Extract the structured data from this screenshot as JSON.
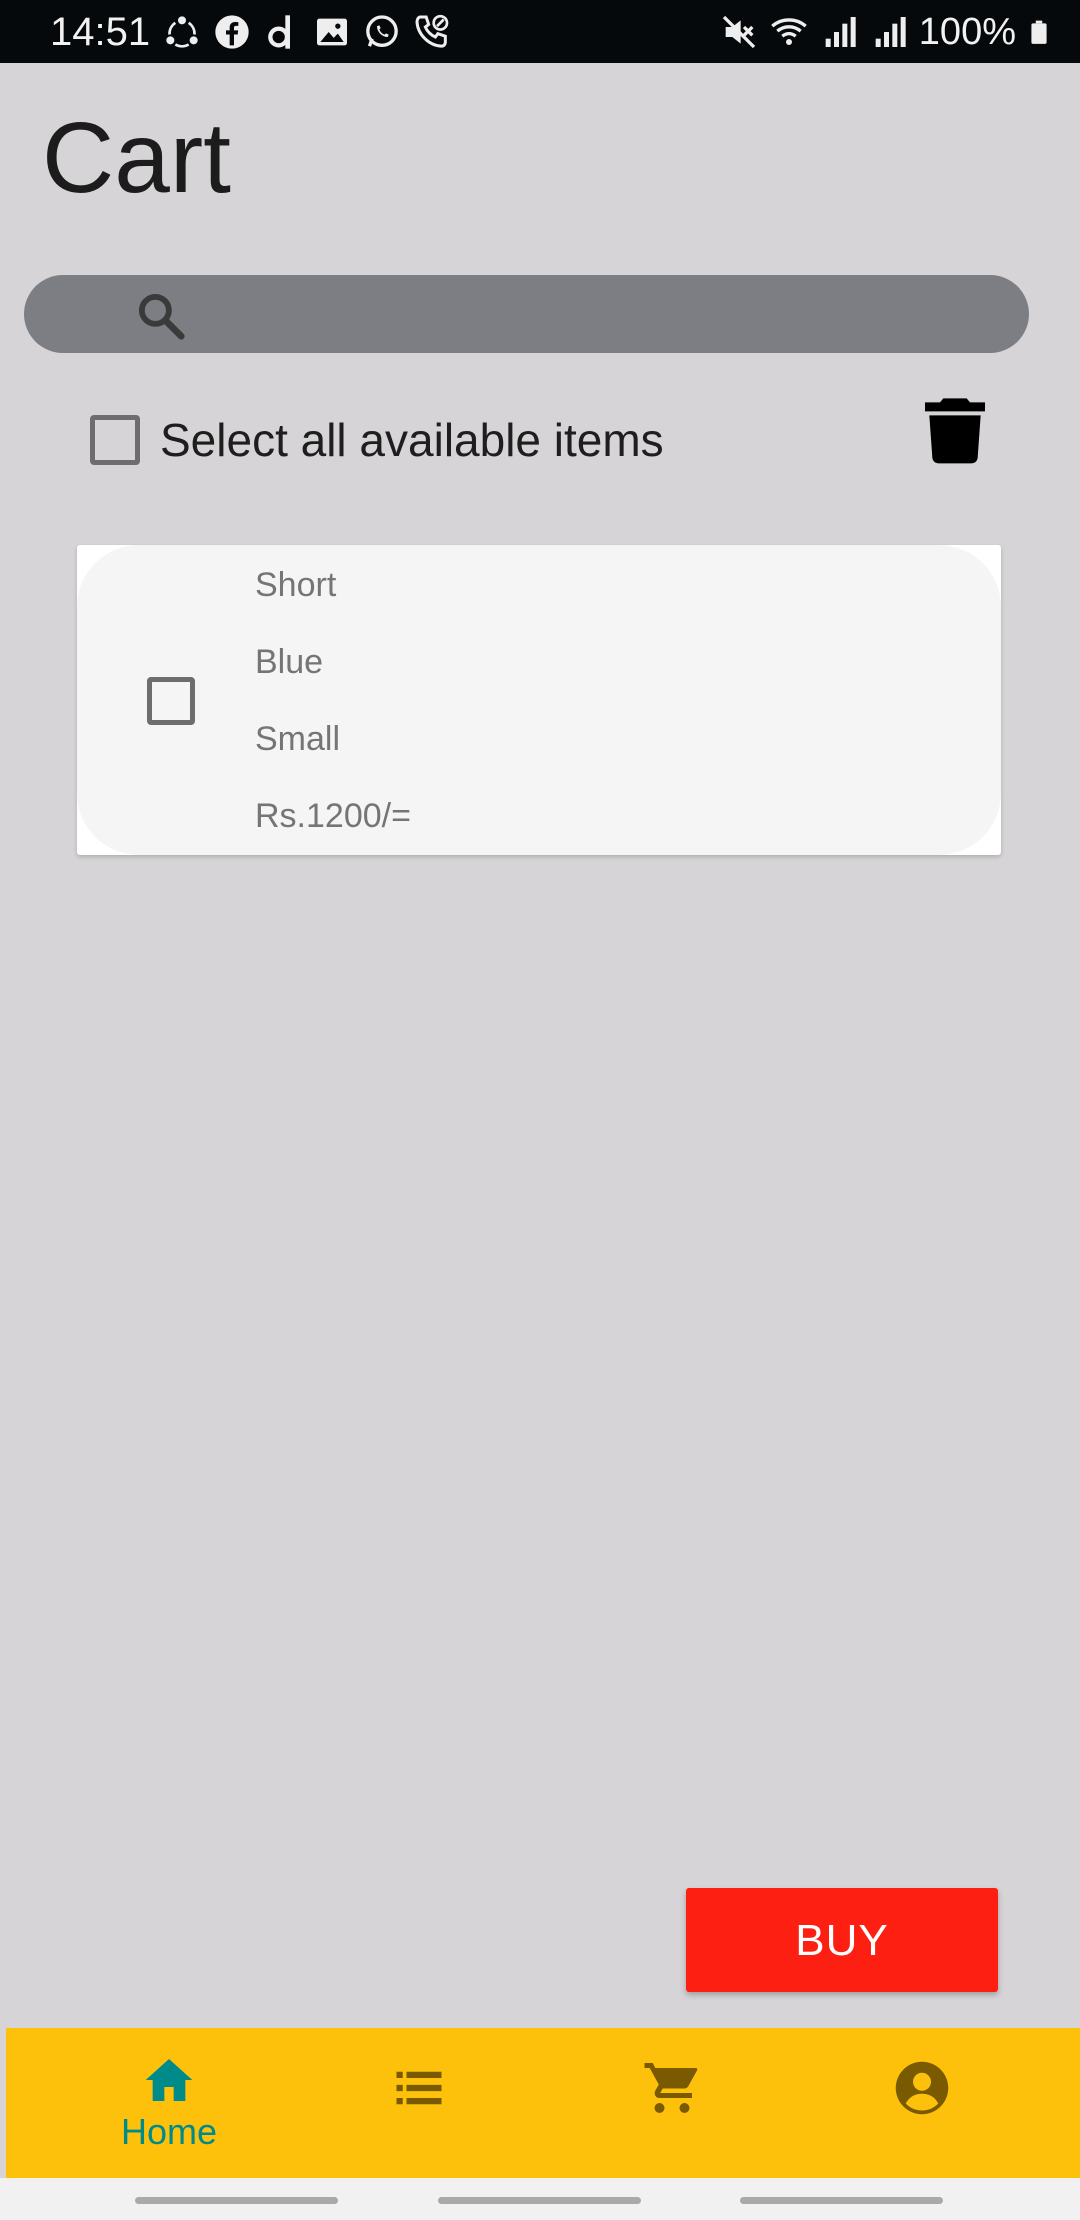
{
  "status_bar": {
    "time": "14:51",
    "battery": "100%",
    "left_icons": [
      "sync-icon",
      "facebook-icon",
      "d-app-icon",
      "gallery-icon",
      "whatsapp-icon",
      "call-icon"
    ],
    "right_icons": [
      "mute-icon",
      "wifi-icon",
      "signal-icon",
      "signal-icon",
      "battery-icon"
    ]
  },
  "page": {
    "title": "Cart"
  },
  "search": {
    "placeholder": "",
    "value": ""
  },
  "select_all": {
    "label": "Select all available items",
    "checked": false
  },
  "cart_items": [
    {
      "name": "Short",
      "color": "Blue",
      "size": "Small",
      "price": "Rs.1200/=",
      "checked": false
    }
  ],
  "actions": {
    "buy_label": "BUY"
  },
  "bottom_nav": {
    "items": [
      {
        "id": "home",
        "label": "Home",
        "icon": "home-icon",
        "active": true
      },
      {
        "id": "orders",
        "label": "",
        "icon": "list-icon",
        "active": false
      },
      {
        "id": "cart",
        "label": "",
        "icon": "cart-icon",
        "active": false
      },
      {
        "id": "profile",
        "label": "",
        "icon": "account-icon",
        "active": false
      }
    ]
  },
  "colors": {
    "background": "#d6d4d6",
    "search_bar": "#7c7e83",
    "buy_button": "#fe1f13",
    "nav_background": "#fdc10b",
    "nav_active": "#008b8b",
    "nav_inactive": "#7a5a00",
    "item_text": "#757575"
  }
}
